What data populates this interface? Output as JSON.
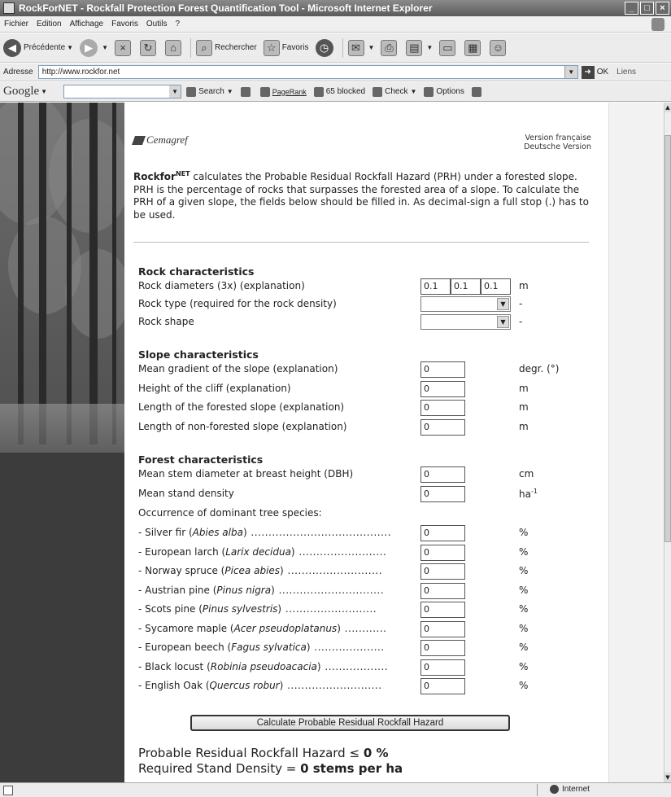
{
  "window": {
    "title": "RockForNET - Rockfall Protection Forest Quantification Tool - Microsoft Internet Explorer"
  },
  "menu": [
    "Fichier",
    "Edition",
    "Affichage",
    "Favoris",
    "Outils",
    "?"
  ],
  "toolbar": {
    "back": "Précédente",
    "search": "Rechercher",
    "favorites": "Favoris"
  },
  "address": {
    "label": "Adresse",
    "url": "http://www.rockfor.net",
    "go": "OK",
    "links": "Liens"
  },
  "google": {
    "logo": "Google",
    "search": "Search",
    "pagerank": "PageRank",
    "blocked": "65 blocked",
    "check": "Check",
    "options": "Options"
  },
  "header": {
    "logo": "Cemagref",
    "lang_fr": "Version française",
    "lang_de": "Deutsche Version"
  },
  "intro": {
    "brand": "Rockfor",
    "brand_sup": "NET",
    "text": " calculates the Probable Residual Rockfall Hazard (PRH) under a forested slope. PRH is the percentage of rocks that surpasses the forested area of a slope. To calculate the PRH of a given slope, the fields below should be filled in. As decimal-sign a full stop (.) has to be used."
  },
  "rock": {
    "title": "Rock characteristics",
    "diameters_label": "Rock diameters (3x) (explanation)",
    "diameters": [
      "0.1",
      "0.1",
      "0.1"
    ],
    "diameters_unit": "m",
    "type_label": "Rock type (required for the rock density)",
    "type_unit": "-",
    "shape_label": "Rock shape",
    "shape_unit": "-"
  },
  "slope": {
    "title": "Slope characteristics",
    "rows": [
      {
        "label": "Mean gradient of the slope (explanation)",
        "value": "0",
        "unit": "degr. (°)"
      },
      {
        "label": "Height of the cliff (explanation)",
        "value": "0",
        "unit": "m"
      },
      {
        "label": "Length of the forested slope (explanation)",
        "value": "0",
        "unit": "m"
      },
      {
        "label": "Length of non-forested slope (explanation)",
        "value": "0",
        "unit": "m"
      }
    ]
  },
  "forest": {
    "title": "Forest characteristics",
    "dbh_label": "Mean stem diameter at breast height (DBH)",
    "dbh_value": "0",
    "dbh_unit": "cm",
    "density_label": "Mean stand density",
    "density_value": "0",
    "density_unit": "ha",
    "density_unit_sup": "-1",
    "occurrence_label": "Occurrence of dominant tree species:",
    "species": [
      {
        "name": "- Silver fir (",
        "latin": "Abies alba",
        "dots": ") ........................................",
        "value": "0",
        "unit": "%"
      },
      {
        "name": "- European larch (",
        "latin": "Larix decidua",
        "dots": ") .........................",
        "value": "0",
        "unit": "%"
      },
      {
        "name": "- Norway spruce (",
        "latin": "Picea abies",
        "dots": ") ...........................",
        "value": "0",
        "unit": "%"
      },
      {
        "name": "- Austrian pine (",
        "latin": "Pinus nigra",
        "dots": ") ..............................",
        "value": "0",
        "unit": "%"
      },
      {
        "name": "- Scots pine (",
        "latin": "Pinus sylvestris",
        "dots": ") ..........................",
        "value": "0",
        "unit": "%"
      },
      {
        "name": "- Sycamore maple (",
        "latin": "Acer pseudoplatanus",
        "dots": ") ............",
        "value": "0",
        "unit": "%"
      },
      {
        "name": "- European beech (",
        "latin": "Fagus sylvatica",
        "dots": ") ....................",
        "value": "0",
        "unit": "%"
      },
      {
        "name": "- Black locust (",
        "latin": "Robinia pseudoacacia",
        "dots": ") ..................",
        "value": "0",
        "unit": "%"
      },
      {
        "name": "- English Oak (",
        "latin": "Quercus robur",
        "dots": ") ...........................",
        "value": "0",
        "unit": "%"
      }
    ]
  },
  "calculate_label": "Calculate Probable Residual Rockfall Hazard",
  "result": {
    "prh_label": "Probable Residual Rockfall Hazard ≤",
    "prh_value": "0 %",
    "density_label": "Required Stand Density =",
    "density_value": "0 stems per ha"
  },
  "status": {
    "zone": "Internet"
  }
}
